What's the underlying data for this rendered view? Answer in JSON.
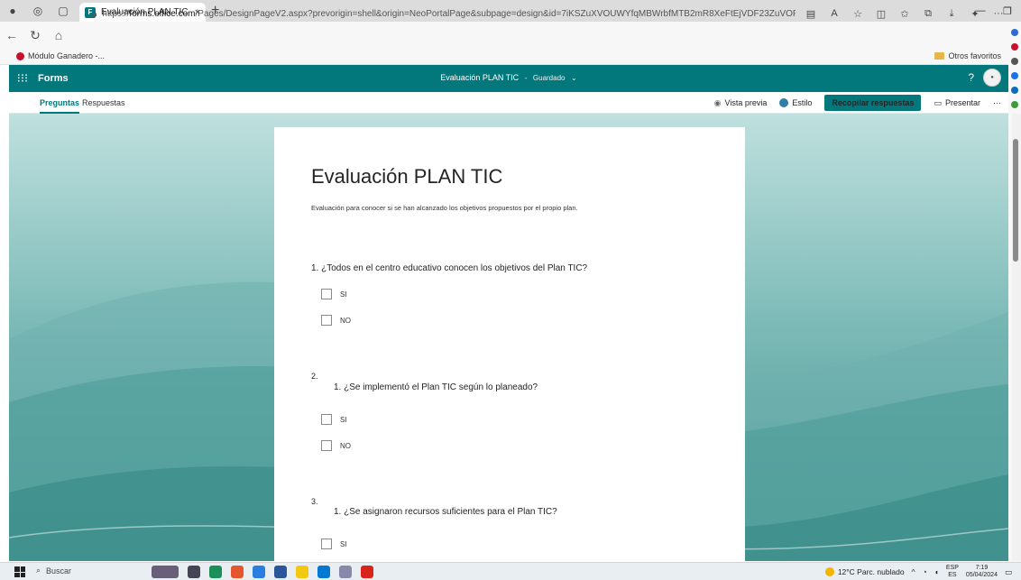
{
  "browser": {
    "tab_title": "Evaluación PLAN TIC",
    "tab_close": "×",
    "new_tab": "+",
    "url_prefix": "https://",
    "url_host": "forms.office.com",
    "url_path": "/Pages/DesignPageV2.aspx?prevorigin=shell&origin=NeoPortalPage&subpage=design&id=7iKSZuXVOUWYfqMBWrbfMTB2mR8XeFtEjVDF23ZuVOFUOFpFTkZFRUYzQURDVFJTWFBQ...",
    "favorites_item": "Módulo Ganadero -...",
    "other_favorites": "Otros favoritos"
  },
  "forms": {
    "app_name": "Forms",
    "header_title": "Evaluación PLAN TIC",
    "header_separator": "-",
    "header_status": "Guardado",
    "help": "?",
    "tabs": {
      "questions": "Preguntas",
      "responses": "Respuestas"
    },
    "toolbar": {
      "preview": "Vista previa",
      "style": "Estilo",
      "collect": "Recopilar respuestas",
      "present": "Presentar",
      "more": "···"
    }
  },
  "form": {
    "title": "Evaluación PLAN TIC",
    "description": "Evaluación para conocer si se han alcanzado los objetivos propuestos por el propio plan.",
    "questions": [
      {
        "number": "1.",
        "text": "¿Todos en el centro educativo conocen los objetivos del Plan TIC?",
        "options": [
          "SI",
          "NO"
        ]
      },
      {
        "number": "2.",
        "text": "1. ¿Se implementó el Plan TIC según lo planeado?",
        "options": [
          "SI",
          "NO"
        ]
      },
      {
        "number": "3.",
        "text": "1. ¿Se asignaron recursos suficientes para el Plan TIC?",
        "options": [
          "SI"
        ]
      }
    ]
  },
  "taskbar": {
    "search": "Buscar",
    "weather": "12°C Parc. nublado",
    "lang": "ESP",
    "lang_region": "ES",
    "time": "7:19",
    "date": "05/04/2024"
  }
}
